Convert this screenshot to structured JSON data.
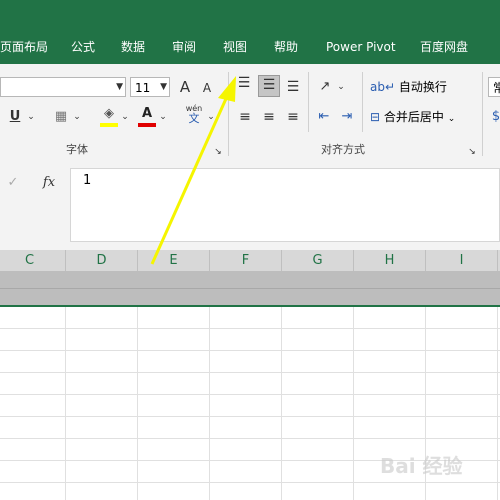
{
  "tabs": [
    "页面布局",
    "公式",
    "数据",
    "审阅",
    "视图",
    "帮助",
    "Power Pivot",
    "百度网盘"
  ],
  "font": {
    "size": "11",
    "grow": "A",
    "shrink": "A",
    "underline": "U",
    "phonetic_top": "wén",
    "phonetic_bottom": "文",
    "group_label": "字体"
  },
  "align": {
    "wrap_label": "自动换行",
    "merge_label": "合并后居中",
    "group_label": "对齐方式"
  },
  "number": {
    "format": "常"
  },
  "formula": {
    "cancel": "✓",
    "fx": "fx",
    "content": "1"
  },
  "columns": [
    "C",
    "D",
    "E",
    "F",
    "G",
    "H",
    "I"
  ],
  "watermark": "Bai 经验"
}
